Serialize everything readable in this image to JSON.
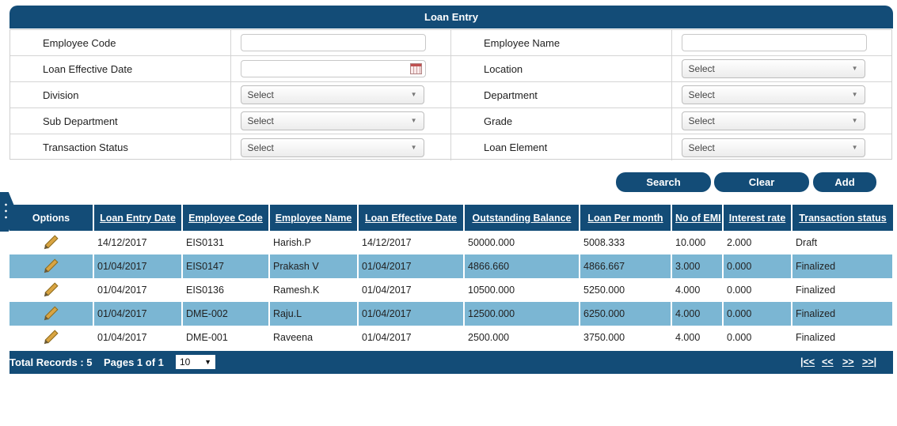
{
  "panel": {
    "title": "Loan Entry"
  },
  "form": {
    "rows": [
      {
        "left_label": "Employee Code",
        "right_label": "Employee Name"
      },
      {
        "left_label": "Loan Effective Date",
        "right_label": "Location",
        "right_value": "Select"
      },
      {
        "left_label": "Division",
        "left_value": "Select",
        "right_label": "Department",
        "right_value": "Select"
      },
      {
        "left_label": "Sub Department",
        "left_value": "Select",
        "right_label": "Grade",
        "right_value": "Select"
      },
      {
        "left_label": "Transaction Status",
        "left_value": "Select",
        "right_label": "Loan Element",
        "right_value": "Select"
      }
    ]
  },
  "actions": {
    "search": "Search",
    "clear": "Clear",
    "add": "Add"
  },
  "table": {
    "headers": [
      "Options",
      "Loan Entry Date",
      "Employee Code",
      "Employee Name",
      "Loan Effective Date",
      "Outstanding Balance",
      "Loan Per month",
      "No of EMI",
      "Interest rate",
      "Transaction status"
    ],
    "rows": [
      [
        "14/12/2017",
        "EIS0131",
        "Harish.P",
        "14/12/2017",
        "50000.000",
        "5008.333",
        "10.000",
        "2.000",
        "Draft"
      ],
      [
        "01/04/2017",
        "EIS0147",
        "Prakash V",
        "01/04/2017",
        "4866.660",
        "4866.667",
        "3.000",
        "0.000",
        "Finalized"
      ],
      [
        "01/04/2017",
        "EIS0136",
        "Ramesh.K",
        "01/04/2017",
        "10500.000",
        "5250.000",
        "4.000",
        "0.000",
        "Finalized"
      ],
      [
        "01/04/2017",
        "DME-002",
        "Raju.L",
        "01/04/2017",
        "12500.000",
        "6250.000",
        "4.000",
        "0.000",
        "Finalized"
      ],
      [
        "01/04/2017",
        "DME-001",
        "Raveena",
        "01/04/2017",
        "2500.000",
        "3750.000",
        "4.000",
        "0.000",
        "Finalized"
      ]
    ]
  },
  "pager": {
    "total_records": "Total Records : 5",
    "pages": "Pages 1 of 1",
    "page_size": "10",
    "first": "|<<",
    "prev": "<<",
    "next": ">>",
    "last": ">>|"
  },
  "colors": {
    "primary": "#134c77",
    "alt_row": "#7bb6d3"
  }
}
